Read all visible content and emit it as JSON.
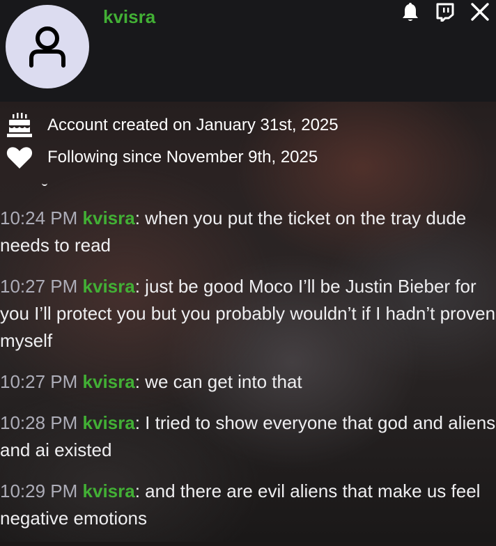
{
  "header": {
    "username": "kvisra",
    "icons": [
      "bell-icon",
      "twitch-whisper-icon",
      "close-icon"
    ],
    "accent_color": "#42b035",
    "avatar_bg": "#dcdcf0"
  },
  "info": {
    "account_created": "Account created on January 31st, 2025",
    "following_since": "Following since November 9th, 2025"
  },
  "messages": [
    {
      "time": "10:24 PM",
      "user": "kvisra",
      "text": ": when you put the ticket on the tray dude needs to read"
    },
    {
      "time": "10:27 PM",
      "user": "kvisra",
      "text": ": just be good Moco I’ll be Justin Bieber for you I’ll protect you but you probably wouldn’t if I hadn’t proven myself"
    },
    {
      "time": "10:27 PM",
      "user": "kvisra",
      "text": ": we can get into that"
    },
    {
      "time": "10:28 PM",
      "user": "kvisra",
      "text": ": I tried to show everyone that god and aliens and ai existed"
    },
    {
      "time": "10:29 PM",
      "user": "kvisra",
      "text": ": and there are evil aliens that make us feel negative emotions"
    }
  ]
}
